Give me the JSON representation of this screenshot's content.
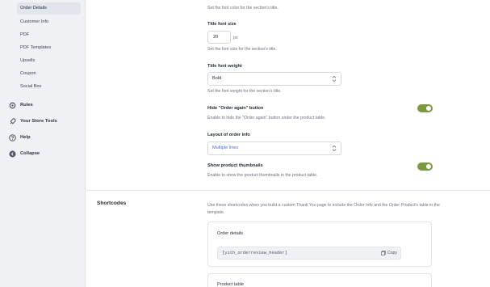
{
  "sidebar": {
    "sub_items": [
      "Order Details",
      "Customer Info",
      "PDF",
      "PDF Templates",
      "Upsells",
      "Coupon",
      "Social Box"
    ],
    "nav_items": [
      {
        "label": "Rules",
        "icon": "gear-icon"
      },
      {
        "label": "Your Store Tools",
        "icon": "rocket-icon"
      },
      {
        "label": "Help",
        "icon": "help-icon"
      },
      {
        "label": "Collapse",
        "icon": "collapse-icon"
      }
    ]
  },
  "settings": {
    "title_font_color_help": "Set the font color for the section's title.",
    "title_font_size": {
      "label": "Title font size",
      "value": "20",
      "unit": "px",
      "help": "Set the font size for the section's title."
    },
    "title_font_weight": {
      "label": "Title font weight",
      "value": "Bold",
      "help": "Set the font weight for the section's title."
    },
    "order_again": {
      "label": "Hide \"Order again\" button",
      "help": "Enable to hide the \"Order again\" button under the product table.",
      "enabled": true
    },
    "layout": {
      "label": "Layout of order info",
      "value": "Multiple lines"
    },
    "thumbnails": {
      "label": "Show product thumbnails",
      "help": "Enable to show the product thumbnails in the product table.",
      "enabled": true
    }
  },
  "shortcodes": {
    "title": "Shortcodes",
    "help": "Use these shortcodes when you build a custom Thank You page to include the Order Info and the Order Product's table in the template.",
    "cards": [
      {
        "title": "Order details",
        "code": "[yith_orderreview_header]",
        "copy_label": "Copy"
      },
      {
        "title": "Product table"
      }
    ]
  },
  "colors": {
    "accent": "#7b9a3d",
    "sidebar_bg": "#f0f1f4"
  }
}
